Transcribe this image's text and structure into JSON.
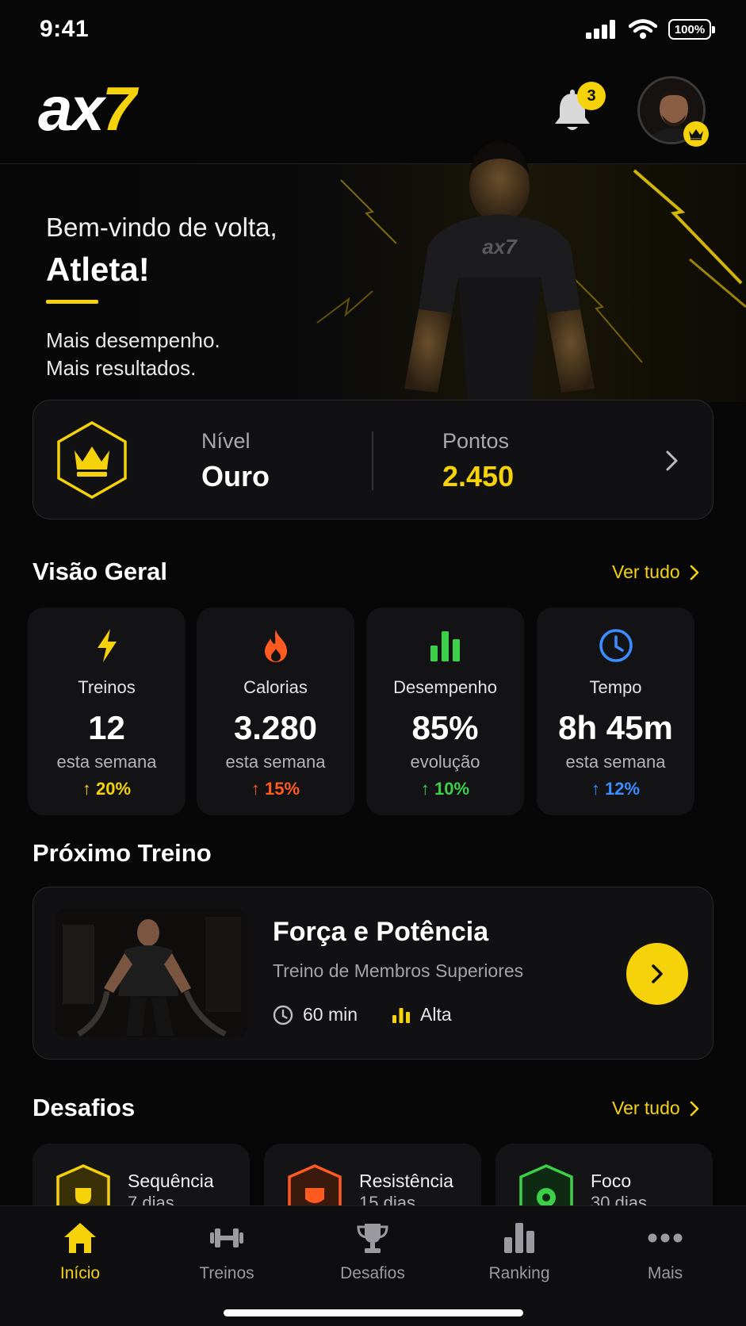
{
  "status_bar": {
    "time": "9:41",
    "battery": "100%"
  },
  "header": {
    "logo_white": "ax",
    "logo_yellow": "7",
    "notifications_count": "3"
  },
  "hero": {
    "greeting": "Bem-vindo de volta,",
    "name": "Atleta!",
    "tagline_1": "Mais desempenho.",
    "tagline_2": "Mais resultados.",
    "shirt_logo": "ax7"
  },
  "level_card": {
    "level_label": "Nível",
    "level_value": "Ouro",
    "points_label": "Pontos",
    "points_value": "2.450"
  },
  "overview": {
    "title": "Visão Geral",
    "see_all": "Ver tudo",
    "stats": [
      {
        "icon": "lightning-icon",
        "label": "Treinos",
        "value": "12",
        "sub": "esta semana",
        "trend": "↑ 20%",
        "color": "#f5d20a"
      },
      {
        "icon": "flame-icon",
        "label": "Calorias",
        "value": "3.280",
        "sub": "esta semana",
        "trend": "↑ 15%",
        "color": "#ff5a1f"
      },
      {
        "icon": "bar-chart-icon",
        "label": "Desempenho",
        "value": "85%",
        "sub": "evolução",
        "trend": "↑ 10%",
        "color": "#3ecf4a"
      },
      {
        "icon": "clock-icon",
        "label": "Tempo",
        "value": "8h 45m",
        "sub": "esta semana",
        "trend": "↑ 12%",
        "color": "#3b8cff"
      }
    ]
  },
  "next_workout": {
    "section_title": "Próximo Treino",
    "title": "Força e Potência",
    "subtitle": "Treino de Membros Superiores",
    "duration": "60 min",
    "intensity": "Alta"
  },
  "challenges": {
    "title": "Desafios",
    "see_all": "Ver tudo",
    "items": [
      {
        "name": "Sequência",
        "days": "7 dias",
        "color": "#f5d20a"
      },
      {
        "name": "Resistência",
        "days": "15 dias",
        "color": "#ff5a1f"
      },
      {
        "name": "Foco",
        "days": "30 dias",
        "color": "#3ecf4a"
      }
    ]
  },
  "tabbar": {
    "items": [
      {
        "label": "Início",
        "icon": "home-icon",
        "active": true
      },
      {
        "label": "Treinos",
        "icon": "dumbbell-icon",
        "active": false
      },
      {
        "label": "Desafios",
        "icon": "trophy-icon",
        "active": false
      },
      {
        "label": "Ranking",
        "icon": "ranking-icon",
        "active": false
      },
      {
        "label": "Mais",
        "icon": "more-icon",
        "active": false
      }
    ]
  },
  "colors": {
    "accent": "#f5d20a",
    "background": "#070708",
    "card": "#111113"
  }
}
